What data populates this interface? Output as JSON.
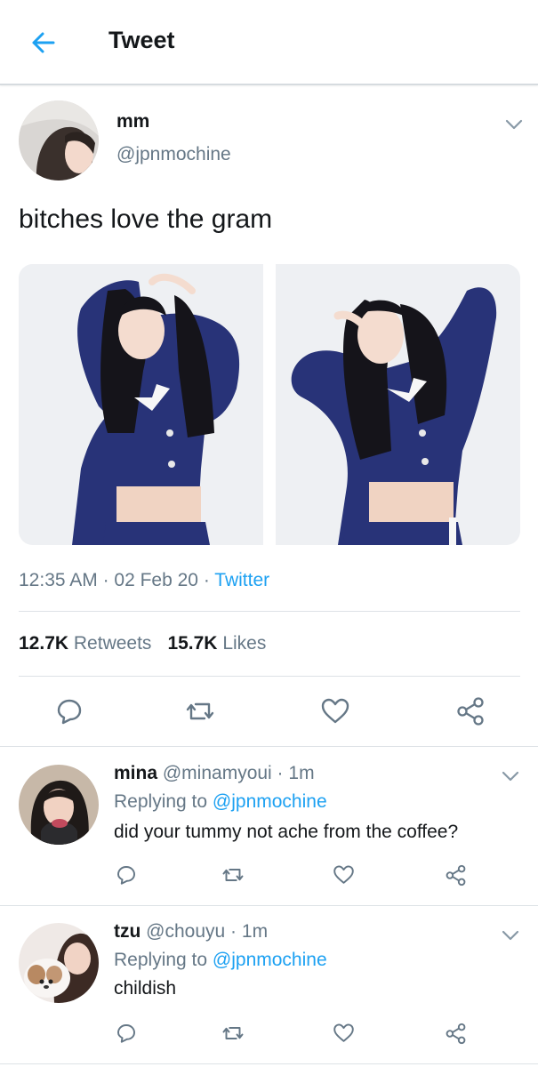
{
  "header": {
    "title": "Tweet",
    "back_icon": "arrow-left-icon",
    "accent": "#1da1f2"
  },
  "tweet": {
    "author_name": "mm",
    "author_handle": "@jpnmochine",
    "text": "bitches love the gram",
    "time": "12:35 AM",
    "date": "02 Feb 20",
    "source": "Twitter",
    "retweets": "12.7K",
    "retweets_label": "Retweets",
    "likes": "15.7K",
    "likes_label": "Likes",
    "actions": [
      "reply-icon",
      "retweet-icon",
      "like-icon",
      "share-icon"
    ]
  },
  "replies": [
    {
      "name": "mina",
      "handle": "@minamyoui",
      "time": "1m",
      "replying_prefix": "Replying to",
      "replying_to": "@jpnmochine",
      "text": "did your tummy not ache from the coffee?"
    },
    {
      "name": "tzu",
      "handle": "@chouyu",
      "time": "1m",
      "replying_prefix": "Replying to",
      "replying_to": "@jpnmochine",
      "text": "childish"
    }
  ],
  "colors": {
    "text": "#14171a",
    "muted": "#657786",
    "link": "#1da1f2",
    "divider": "#dde2e6",
    "icon": "#657786"
  }
}
